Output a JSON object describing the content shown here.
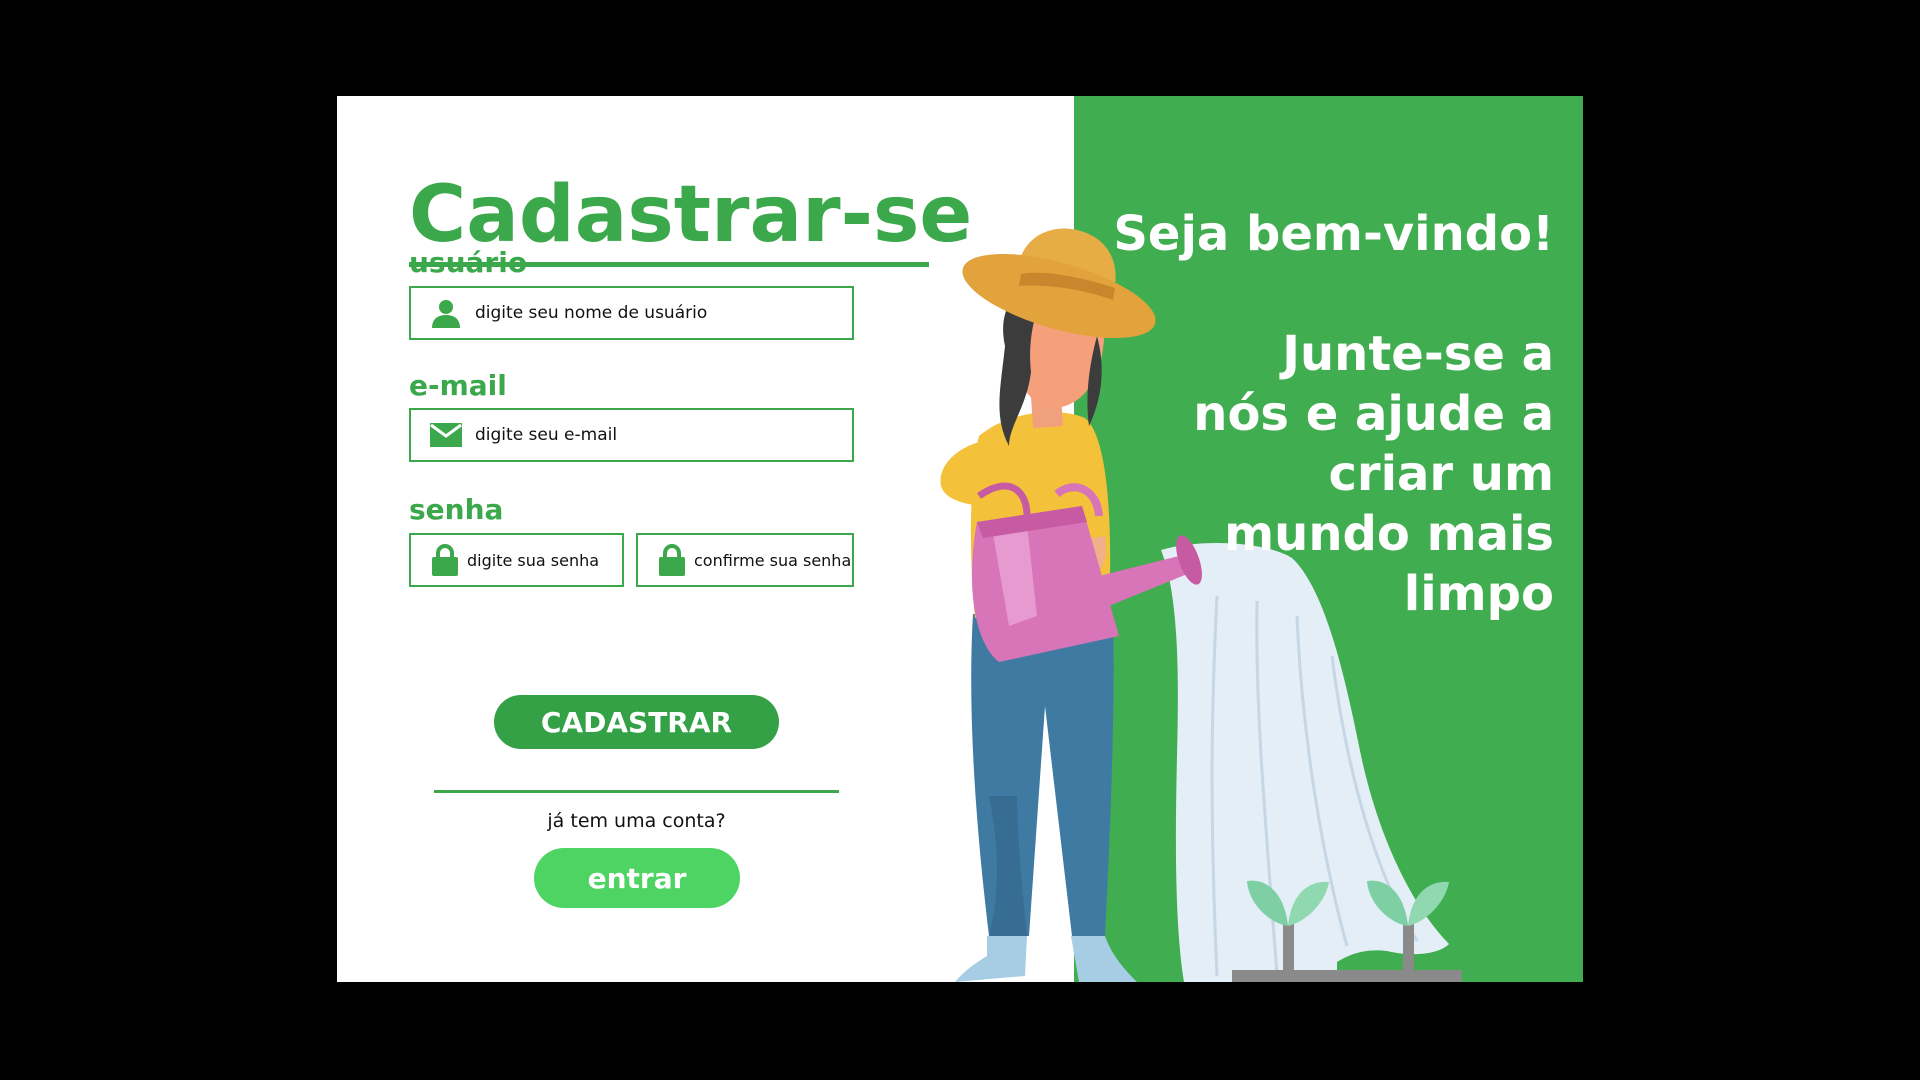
{
  "form": {
    "title": "Cadastrar-se",
    "username_label": "usuário",
    "username_placeholder": "digite seu nome de usuário",
    "email_label": "e-mail",
    "email_placeholder": "digite seu e-mail",
    "password_label": "senha",
    "password_placeholder": "digite sua senha",
    "confirm_placeholder": "confirme sua senha",
    "submit_label": "CADASTRAR",
    "has_account_text": "já tem uma conta?",
    "login_label": "entrar"
  },
  "panel": {
    "welcome": "Seja bem-vindo!",
    "slogan": "Junte-se a nós e ajude a criar um mundo mais limpo"
  },
  "icons": {
    "username": "user-icon",
    "email": "envelope-icon",
    "password": "lock-icon",
    "confirm": "lock-icon"
  },
  "colors": {
    "background": "#000000",
    "card": "#ffffff",
    "brand_green": "#3ba84b",
    "panel_green": "#41ad51",
    "submit_button": "#34a146",
    "login_button": "#4dd463",
    "watering_can": "#d874b8",
    "shirt": "#f3c13a",
    "jeans": "#3f7aa2",
    "hat": "#e2a33c",
    "leaf": "#7fcfa5",
    "water": "#e4eef6"
  }
}
